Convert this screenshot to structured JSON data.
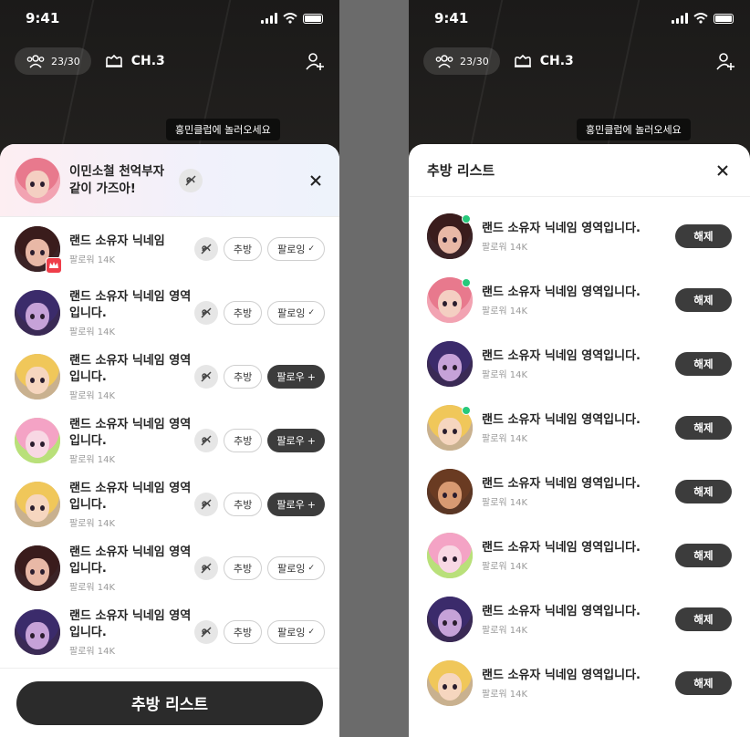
{
  "status": {
    "time": "9:41"
  },
  "topbar": {
    "members": "23/30",
    "channel": "CH.3"
  },
  "tooltip": "홍민클럽에 놀러오세요",
  "left_sheet": {
    "host_message": "이민소철 천억부자 같이 가즈아!",
    "recommend_label": "추방",
    "following_label": "팔로잉",
    "follow_label": "팔로우",
    "rows": [
      {
        "name": "랜드 소유자 닉네임",
        "followers": "팔로워 14K",
        "following": true,
        "avatar": "a1",
        "crown": true
      },
      {
        "name": "랜드 소유자 닉네임 영역입니다.",
        "followers": "팔로워 14K",
        "following": true,
        "avatar": "a3",
        "crown": false
      },
      {
        "name": "랜드 소유자 닉네임 영역입니다.",
        "followers": "팔로워 14K",
        "following": false,
        "avatar": "a4",
        "crown": false
      },
      {
        "name": "랜드 소유자 닉네임 영역입니다.",
        "followers": "팔로워 14K",
        "following": false,
        "avatar": "a6",
        "crown": false
      },
      {
        "name": "랜드 소유자 닉네임 영역입니다.",
        "followers": "팔로워 14K",
        "following": false,
        "avatar": "a4",
        "crown": false
      },
      {
        "name": "랜드 소유자 닉네임 영역입니다.",
        "followers": "팔로워 14K",
        "following": true,
        "avatar": "a1",
        "crown": false
      },
      {
        "name": "랜드 소유자 닉네임 영역입니다.",
        "followers": "팔로워 14K",
        "following": true,
        "avatar": "a3",
        "crown": false
      }
    ],
    "bottom_button": "추방 리스트"
  },
  "right_sheet": {
    "title": "추방 리스트",
    "release_label": "해제",
    "rows": [
      {
        "name": "랜드 소유자 닉네임 영역입니다.",
        "followers": "팔로워 14K",
        "avatar": "a1",
        "online": true
      },
      {
        "name": "랜드 소유자 닉네임 영역입니다.",
        "followers": "팔로워 14K",
        "avatar": "a2",
        "online": true
      },
      {
        "name": "랜드 소유자 닉네임 영역입니다.",
        "followers": "팔로워 14K",
        "avatar": "a3",
        "online": false
      },
      {
        "name": "랜드 소유자 닉네임 영역입니다.",
        "followers": "팔로워 14K",
        "avatar": "a4",
        "online": true
      },
      {
        "name": "랜드 소유자 닉네임 영역입니다.",
        "followers": "팔로워 14K",
        "avatar": "a5",
        "online": false
      },
      {
        "name": "랜드 소유자 닉네임 영역입니다.",
        "followers": "팔로워 14K",
        "avatar": "a6",
        "online": false
      },
      {
        "name": "랜드 소유자 닉네임 영역입니다.",
        "followers": "팔로워 14K",
        "avatar": "a3",
        "online": false
      },
      {
        "name": "랜드 소유자 닉네임 영역입니다.",
        "followers": "팔로워 14K",
        "avatar": "a4",
        "online": false
      }
    ]
  },
  "colors": {
    "dark_button": "#3c3c3c",
    "online": "#27c97b",
    "crown_badge": "#ef3e4a"
  }
}
